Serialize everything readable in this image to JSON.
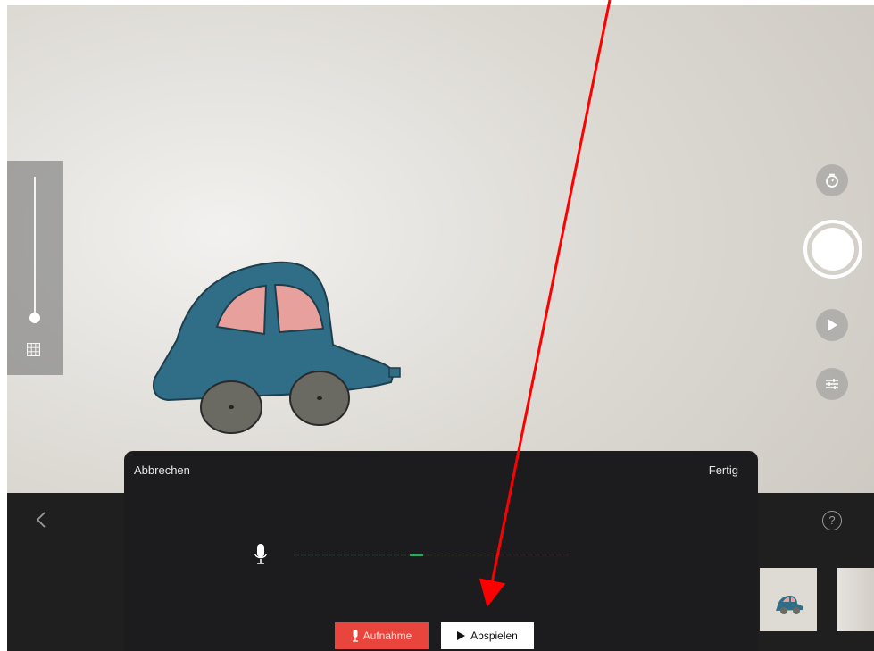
{
  "camera": {
    "zoom_level": 0.0,
    "icons": [
      "grid-icon",
      "timer-icon",
      "play-icon",
      "settings-sliders-icon",
      "shutter"
    ]
  },
  "bottom_bar": {
    "back_icon": "chevron-left-icon",
    "help_icon": "question-circle-icon",
    "help_glyph": "?"
  },
  "record_sheet": {
    "cancel_label": "Abbrechen",
    "done_label": "Fertig",
    "record_label": "Aufnahme",
    "play_label": "Abspielen",
    "mic_icon": "microphone-icon"
  },
  "annotation": {
    "arrow_color": "#ff0000"
  },
  "colors": {
    "record_red": "#e8453c",
    "car_blue": "#2f6e86",
    "window_pink": "#e8a09c"
  }
}
